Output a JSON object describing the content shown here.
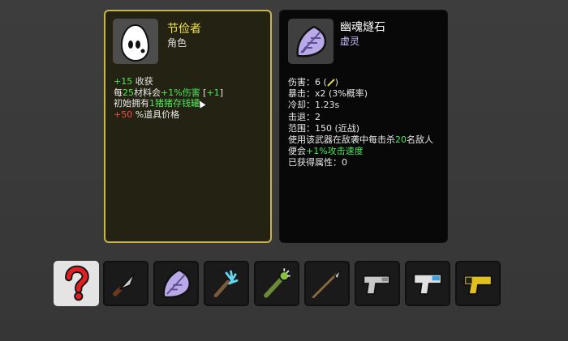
{
  "character": {
    "name": "节俭者",
    "role": "角色",
    "icon": "egg-face-icon",
    "stats": [
      {
        "value": "+15",
        "text": " 收获"
      },
      {
        "prefix": "每",
        "amount": "25",
        "middle": "材料会",
        "bonus": "+1%伤害",
        "bracket_open": " [",
        "bracket_value": "+1",
        "bracket_close": "]"
      },
      {
        "prefix": "初始拥有",
        "amount": "1",
        "item": "猪猪存钱罐"
      },
      {
        "value": "+50",
        "text": " %道具价格"
      }
    ]
  },
  "weapon": {
    "name": "幽魂燧石",
    "type": "虚灵",
    "icon": "ghost-flint-icon",
    "stats": {
      "damage_label": "伤害：",
      "damage_value": "6 (",
      "damage_close": ")",
      "crit_label": "暴击：",
      "crit_value": "x2 (3%概率)",
      "cooldown_label": "冷却：",
      "cooldown_value": "1.23s",
      "knockback_label": "击退：",
      "knockback_value": "2",
      "range_label": "范围：",
      "range_value": "150 (近战)"
    },
    "effect_line1_a": "使用该武器在敌袭中每击杀",
    "effect_line1_amount": "20",
    "effect_line1_b": "名敌人",
    "effect_line2_a": "便会",
    "effect_line2_bonus": "+1%攻击速度",
    "attributes_label": "已获得属性：",
    "attributes_value": "0"
  },
  "slots": [
    {
      "icon": "question-mark-icon",
      "selected": true
    },
    {
      "icon": "knife-icon",
      "selected": false
    },
    {
      "icon": "ghost-flint-icon",
      "selected": false
    },
    {
      "icon": "ice-scepter-icon",
      "selected": false
    },
    {
      "icon": "spiked-club-icon",
      "selected": false
    },
    {
      "icon": "spear-icon",
      "selected": false
    },
    {
      "icon": "pistol-icon",
      "selected": false
    },
    {
      "icon": "smg-icon",
      "selected": false
    },
    {
      "icon": "taser-icon",
      "selected": false
    }
  ],
  "colors": {
    "character_border": "#c8b64a",
    "character_title": "#f1e14a",
    "weapon_type": "#ccc0ff",
    "positive": "#4de65a",
    "negative": "#ff4a4a"
  }
}
